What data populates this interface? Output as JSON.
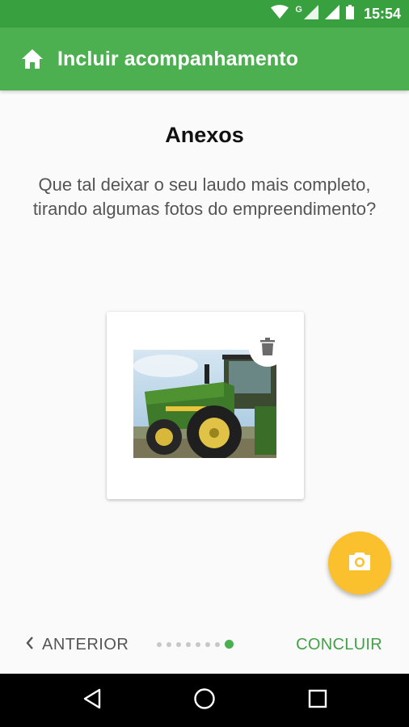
{
  "status_bar": {
    "time": "15:54",
    "network_letter": "G",
    "icons": [
      "wifi-icon",
      "cell-signal-icon",
      "cell-signal-icon",
      "battery-icon"
    ]
  },
  "app_bar": {
    "title": "Incluir acompanhamento",
    "icon": "home-icon"
  },
  "main": {
    "section_title": "Anexos",
    "description": "Que tal deixar o seu laudo mais completo, tirando algumas fotos do empreendimento?"
  },
  "attachments": [
    {
      "thumbnail": "green tractor photo",
      "delete_icon": "trash-icon"
    }
  ],
  "fab": {
    "icon": "camera-icon",
    "color": "#fbc02d"
  },
  "stepper": {
    "previous_label": "ANTERIOR",
    "next_label": "CONCLUIR",
    "total_steps": 8,
    "current_step": 8
  },
  "nav_bar": {
    "icons": [
      "back-icon",
      "home-circle-icon",
      "recents-icon"
    ]
  },
  "colors": {
    "primary": "#4caf50",
    "status_bar": "#39a03f",
    "accent": "#fbc02d"
  }
}
